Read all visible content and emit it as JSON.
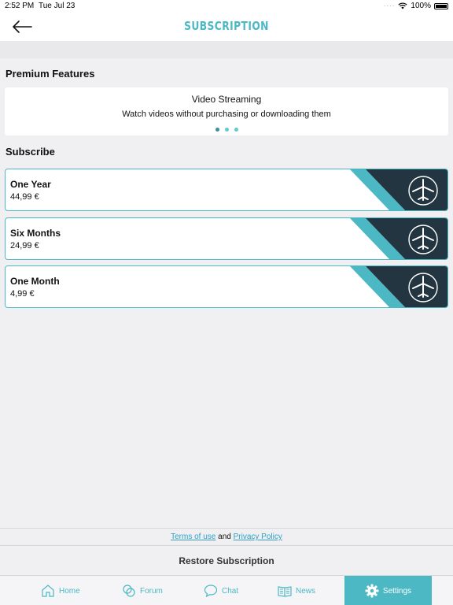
{
  "status": {
    "time": "2:52 PM",
    "date": "Tue Jul 23",
    "battery": "100%"
  },
  "header": {
    "title": "SUBSCRIPTION"
  },
  "premium": {
    "title": "Premium Features",
    "feature_title": "Video Streaming",
    "feature_desc": "Watch videos without purchasing or downloading them",
    "slides": 3,
    "active_slide": 0
  },
  "subscribe": {
    "title": "Subscribe",
    "plans": [
      {
        "name": "One Year",
        "price": "44,99 €"
      },
      {
        "name": "Six Months",
        "price": "24,99 €"
      },
      {
        "name": "One Month",
        "price": "4,99 €"
      }
    ]
  },
  "footer": {
    "terms": "Terms of use",
    "and": "and",
    "privacy": "Privacy Policy",
    "restore": "Restore Subscription"
  },
  "tabs": [
    {
      "label": "Home",
      "icon": "home-icon"
    },
    {
      "label": "Forum",
      "icon": "forum-icon"
    },
    {
      "label": "Chat",
      "icon": "chat-icon"
    },
    {
      "label": "News",
      "icon": "news-icon"
    },
    {
      "label": "Settings",
      "icon": "gear-icon"
    }
  ],
  "colors": {
    "accent": "#4bb8c4",
    "dark": "#233540",
    "link": "#2e9fc2"
  }
}
